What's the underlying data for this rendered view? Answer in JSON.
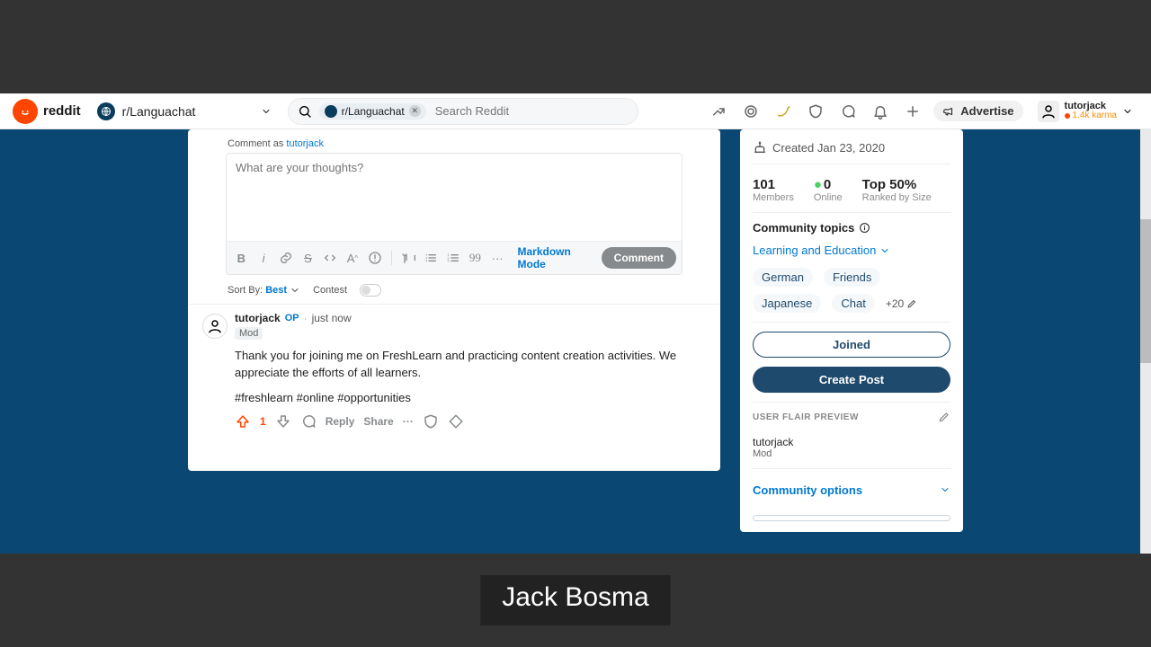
{
  "brand": "reddit",
  "subreddit": "r/Languachat",
  "search": {
    "chip": "r/Languachat",
    "placeholder": "Search Reddit"
  },
  "advertise": "Advertise",
  "user": {
    "name": "tutorjack",
    "karma": "1.4k karma"
  },
  "editor": {
    "comment_as_prefix": "Comment as ",
    "comment_as_user": "tutorjack",
    "placeholder": "What are your thoughts?",
    "markdown_mode": "Markdown Mode",
    "submit": "Comment"
  },
  "sort": {
    "label": "Sort By:",
    "value": "Best",
    "contest": "Contest"
  },
  "comment": {
    "author": "tutorjack",
    "op": "OP",
    "time": "just now",
    "mod": "Mod",
    "body": "Thank you for joining me on FreshLearn and practicing content creation activities. We appreciate the efforts of all learners.",
    "hashtags": "#freshlearn #online #opportunities",
    "score": "1",
    "reply": "Reply",
    "share": "Share"
  },
  "sidebar": {
    "created_prefix": "Created ",
    "created_date": "Jan 23, 2020",
    "members_val": "101",
    "members_lab": "Members",
    "online_val": "0",
    "online_lab": "Online",
    "rank_val": "Top 50%",
    "rank_lab": "Ranked by Size",
    "topics_label": "Community topics",
    "topics_link": "Learning and Education",
    "pills": [
      "German",
      "Friends",
      "Japanese",
      "Chat"
    ],
    "more_topics": "+20",
    "joined": "Joined",
    "create_post": "Create Post",
    "flair_header": "USER FLAIR PREVIEW",
    "flair_name": "tutorjack",
    "flair_badge": "Mod",
    "community_options": "Community options"
  },
  "overlay": "Jack Bosma"
}
